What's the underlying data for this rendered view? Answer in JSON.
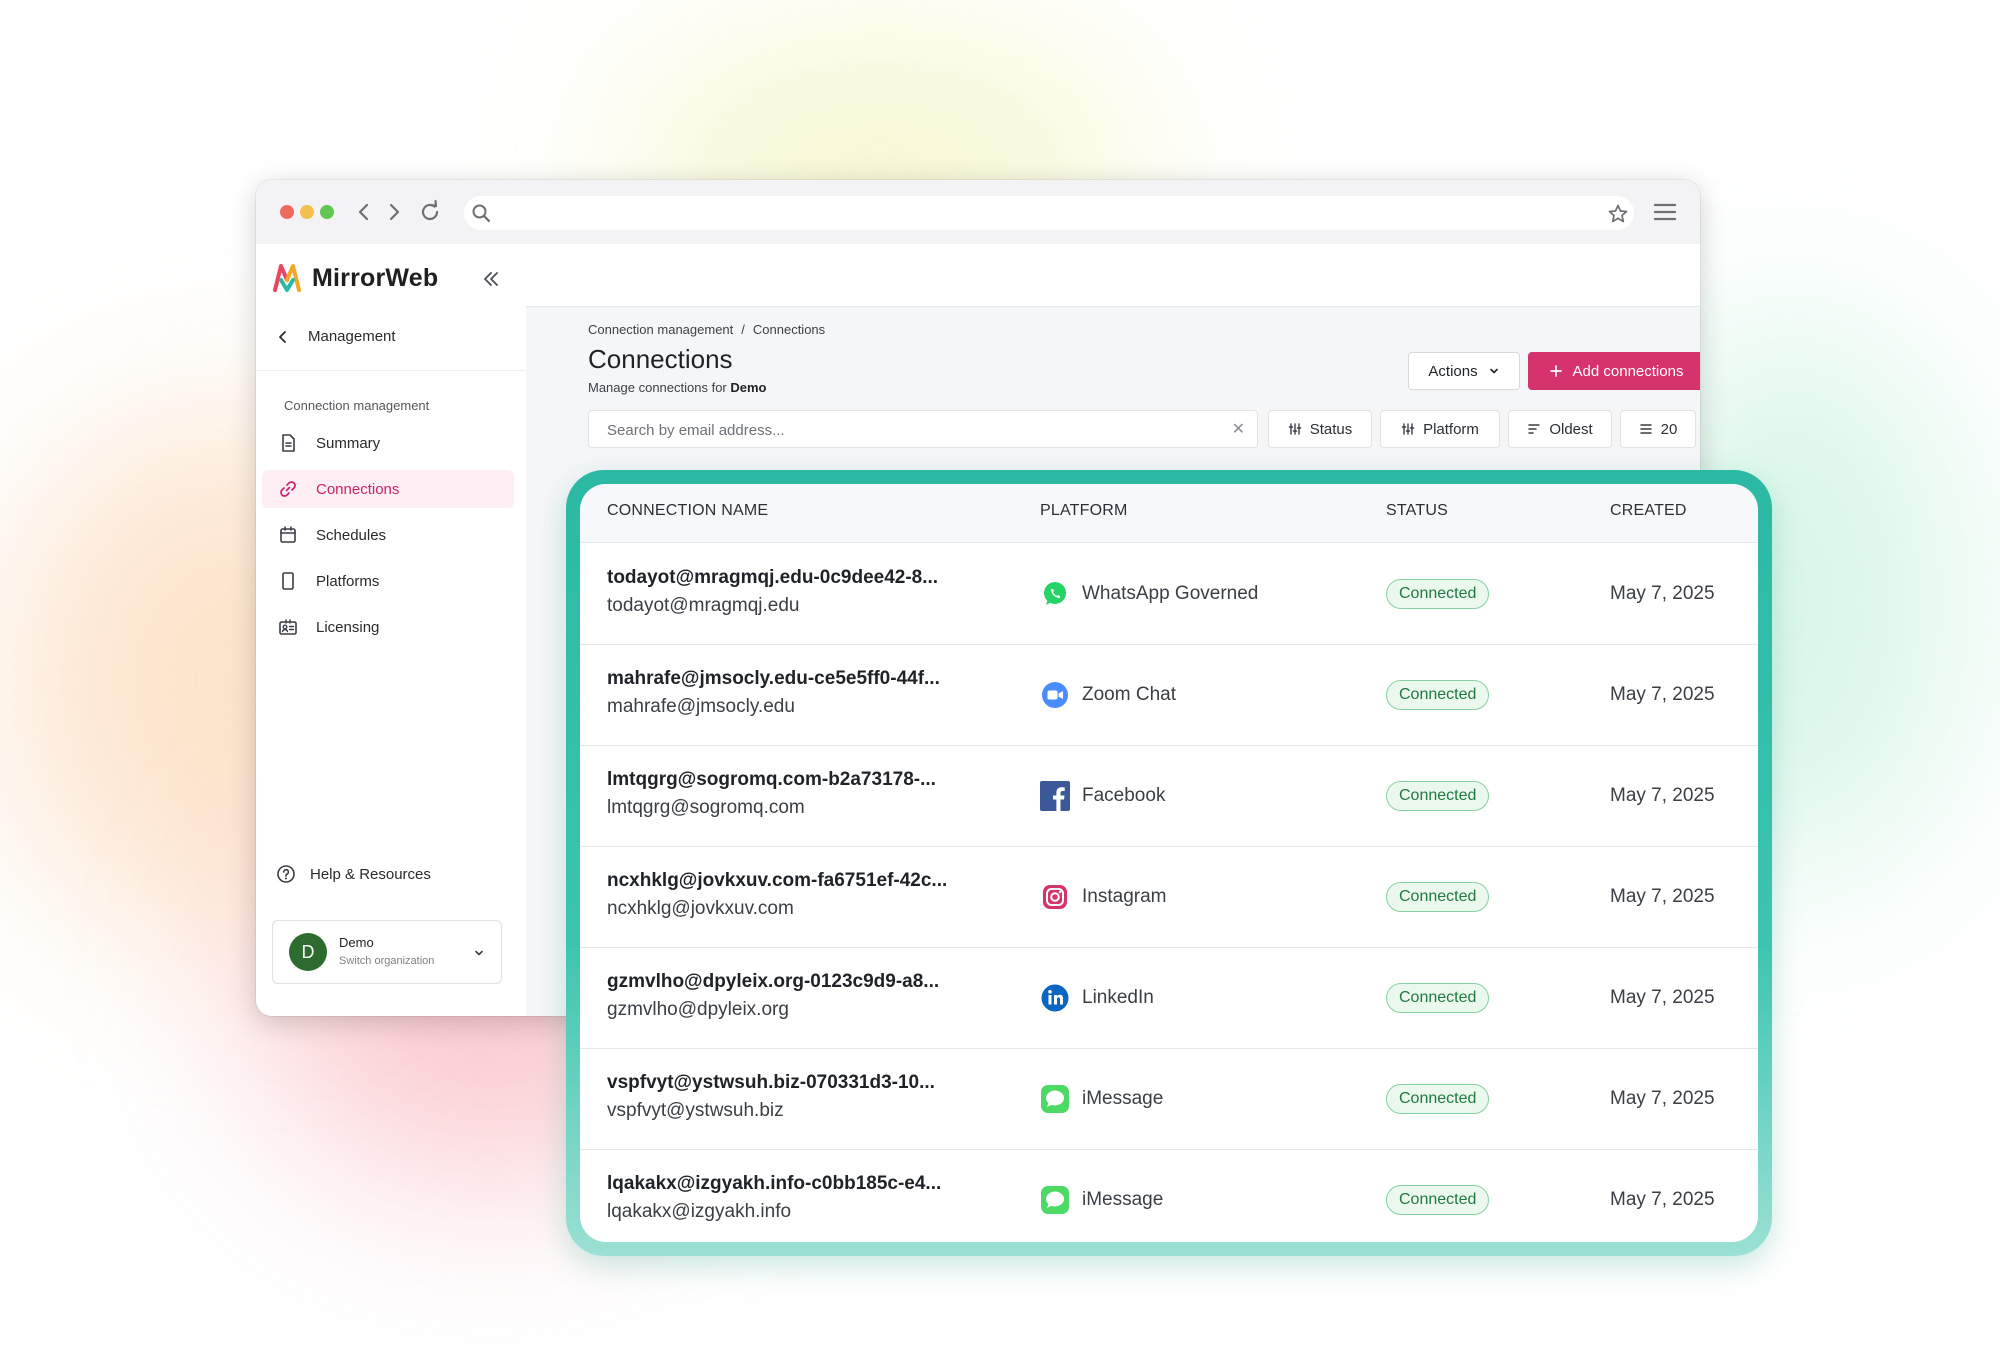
{
  "app": {
    "logo_text": "MirrorWeb",
    "back_label": "Management",
    "group_label": "Connection management",
    "sidebar_items": [
      {
        "label": "Summary",
        "icon": "document-icon"
      },
      {
        "label": "Connections",
        "icon": "link-icon",
        "active": true
      },
      {
        "label": "Schedules",
        "icon": "calendar-icon"
      },
      {
        "label": "Platforms",
        "icon": "device-icon"
      },
      {
        "label": "Licensing",
        "icon": "id-card-icon"
      }
    ],
    "help_label": "Help & Resources",
    "org": {
      "initial": "D",
      "name": "Demo",
      "sub": "Switch organization"
    }
  },
  "page": {
    "breadcrumb": [
      "Connection management",
      "Connections"
    ],
    "title": "Connections",
    "subtitle_prefix": "Manage connections for ",
    "subtitle_org": "Demo",
    "actions_label": "Actions",
    "add_label": "Add connections",
    "search_placeholder": "Search by email address...",
    "filters": {
      "status": "Status",
      "platform": "Platform",
      "sort": "Oldest",
      "count": "20"
    }
  },
  "table": {
    "columns": [
      "CONNECTION NAME",
      "PLATFORM",
      "STATUS",
      "CREATED"
    ],
    "rows": [
      {
        "name": "todayot@mragmqj.edu-0c9dee42-8...",
        "email": "todayot@mragmqj.edu",
        "platform": "WhatsApp Governed",
        "icon": "whatsapp-icon",
        "status": "Connected",
        "created": "May 7, 2025"
      },
      {
        "name": "mahrafe@jmsocly.edu-ce5e5ff0-44f...",
        "email": "mahrafe@jmsocly.edu",
        "platform": "Zoom Chat",
        "icon": "zoom-icon",
        "status": "Connected",
        "created": "May 7, 2025"
      },
      {
        "name": "lmtqgrg@sogromq.com-b2a73178-...",
        "email": "lmtqgrg@sogromq.com",
        "platform": "Facebook",
        "icon": "facebook-icon",
        "status": "Connected",
        "created": "May 7, 2025"
      },
      {
        "name": "ncxhklg@jovkxuv.com-fa6751ef-42c...",
        "email": "ncxhklg@jovkxuv.com",
        "platform": "Instagram",
        "icon": "instagram-icon",
        "status": "Connected",
        "created": "May 7, 2025"
      },
      {
        "name": "gzmvlho@dpyleix.org-0123c9d9-a8...",
        "email": "gzmvlho@dpyleix.org",
        "platform": "LinkedIn",
        "icon": "linkedin-icon",
        "status": "Connected",
        "created": "May 7, 2025"
      },
      {
        "name": "vspfvyt@ystwsuh.biz-070331d3-10...",
        "email": "vspfvyt@ystwsuh.biz",
        "platform": "iMessage",
        "icon": "imessage-icon",
        "status": "Connected",
        "created": "May 7, 2025"
      },
      {
        "name": "lqakakx@izgyakh.info-c0bb185c-e4...",
        "email": "lqakakx@izgyakh.info",
        "platform": "iMessage",
        "icon": "imessage-icon",
        "status": "Connected",
        "created": "May 7, 2025"
      }
    ]
  },
  "colors": {
    "accent": "#d6336c",
    "active_bg": "#fdeef4",
    "status_green": "#1f7a40",
    "card_ring": "#2bb9a4"
  }
}
